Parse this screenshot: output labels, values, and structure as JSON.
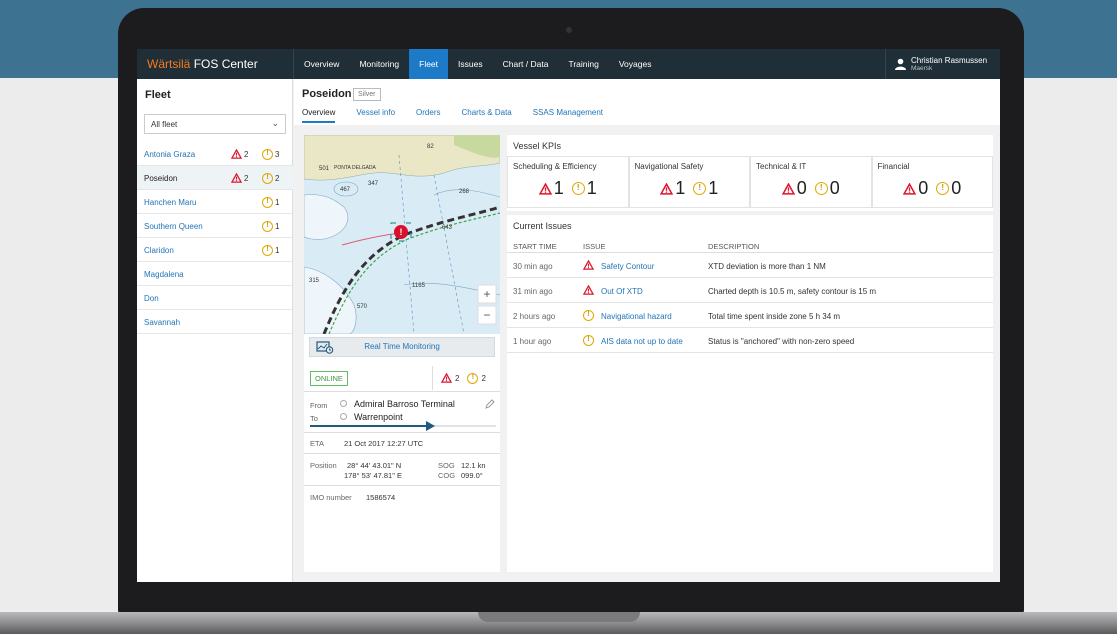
{
  "app": {
    "brand_a": "Wärtsilä",
    "brand_b": "FOS Center"
  },
  "nav": [
    "Overview",
    "Monitoring",
    "Fleet",
    "Issues",
    "Chart / Data",
    "Training",
    "Voyages"
  ],
  "user": {
    "name": "Christian Rasmussen",
    "org": "Maersk"
  },
  "sidebar": {
    "title": "Fleet",
    "filter": "All fleet",
    "vessels": [
      {
        "name": "Antonia Graza",
        "alarms": "2",
        "warnings": "3"
      },
      {
        "name": "Poseidon",
        "alarms": "2",
        "warnings": "2"
      },
      {
        "name": "Hanchen Maru",
        "alarms": "",
        "warnings": "1"
      },
      {
        "name": "Southern Queen",
        "alarms": "",
        "warnings": "1"
      },
      {
        "name": "Claridon",
        "alarms": "",
        "warnings": "1"
      },
      {
        "name": "Magdalena",
        "alarms": "",
        "warnings": ""
      },
      {
        "name": "Don",
        "alarms": "",
        "warnings": ""
      },
      {
        "name": "Savannah",
        "alarms": "",
        "warnings": ""
      }
    ]
  },
  "vessel": {
    "name": "Poseidon",
    "badge": "Silver",
    "tabs": [
      "Overview",
      "Vessel info",
      "Orders",
      "Charts & Data",
      "SSAS Management"
    ]
  },
  "map": {
    "labels": [
      "82",
      "PONTA DELGADA",
      "347",
      "501",
      "467",
      "268",
      "643",
      "315",
      "1165",
      "570"
    ],
    "zoom_in": "+",
    "zoom_out": "−",
    "alert_mark": "!"
  },
  "monitor": {
    "button": "Real Time Monitoring",
    "status": "ONLINE",
    "alarms": "2",
    "warnings": "2",
    "from_label": "From",
    "from": "Admiral Barroso Terminal",
    "to_label": "To",
    "to": "Warrenpoint",
    "voyage_progress": 0.65,
    "eta_label": "ETA",
    "eta": "21 Oct 2017  12:27 UTC",
    "position_label": "Position",
    "lat": "28° 44' 43.01\" N",
    "lon": "178° 53' 47.81\" E",
    "sog_label": "SOG",
    "sog": "12.1 kn",
    "cog_label": "COG",
    "cog": "099.0°",
    "imo_label": "IMO number",
    "imo": "1586574"
  },
  "kpis": {
    "title": "Vessel KPIs",
    "items": [
      {
        "label": "Scheduling & Efficiency",
        "alarms": "1",
        "warnings": "1"
      },
      {
        "label": "Navigational Safety",
        "alarms": "1",
        "warnings": "1"
      },
      {
        "label": "Technical & IT",
        "alarms": "0",
        "warnings": "0"
      },
      {
        "label": "Financial",
        "alarms": "0",
        "warnings": "0"
      }
    ]
  },
  "issues": {
    "title": "Current Issues",
    "headers": [
      "START TIME",
      "ISSUE",
      "DESCRIPTION"
    ],
    "rows": [
      {
        "time": "30 min ago",
        "type": "alarm",
        "issue": "Safety Contour",
        "desc": "XTD deviation is more than 1 NM"
      },
      {
        "time": "31 min ago",
        "type": "alarm",
        "issue": "Out Of XTD",
        "desc": "Charted depth is 10.5 m, safety contour is 15 m"
      },
      {
        "time": "2 hours ago",
        "type": "warning",
        "issue": "Navigational hazard",
        "desc": "Total time spent inside zone 5 h 34 m"
      },
      {
        "time": "1 hour  ago",
        "type": "warning",
        "issue": "AIS data not up to date",
        "desc": "Status is \"anchored\" with non-zero speed"
      }
    ]
  },
  "colors": {
    "accent": "#1d7ac8",
    "brand": "#f47b20",
    "alarm": "#e0142b",
    "warning": "#e0a800",
    "topbar": "#1f2e37"
  }
}
